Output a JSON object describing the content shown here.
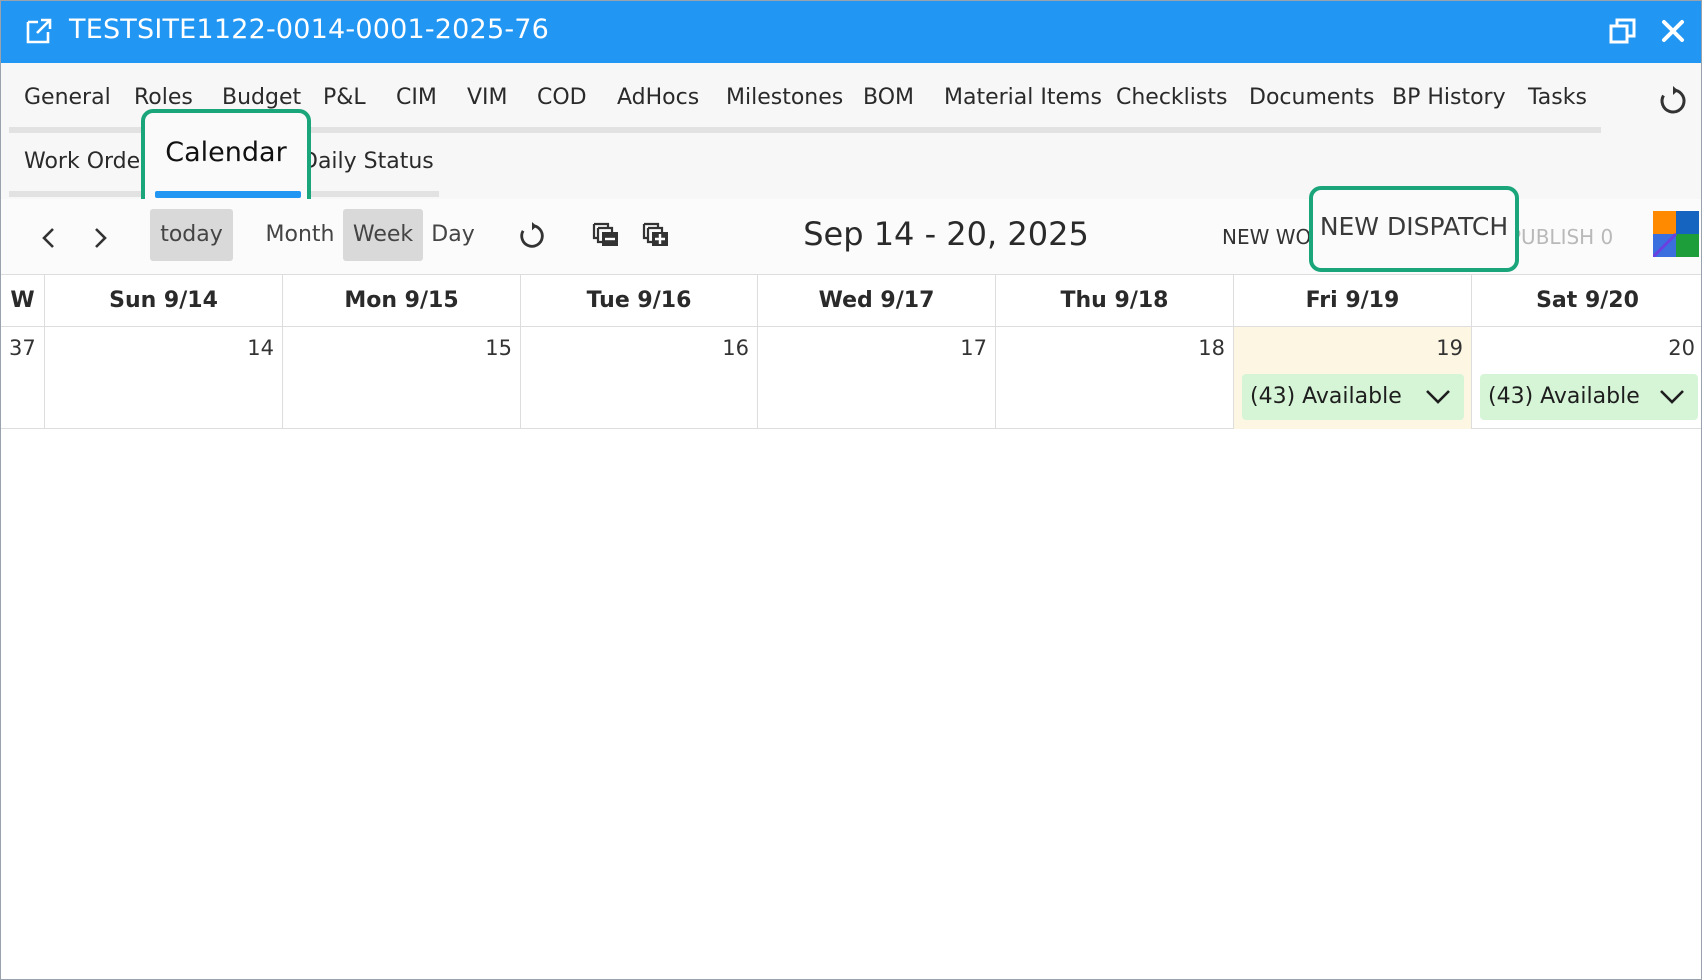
{
  "window": {
    "title": "TESTSITE1122-0014-0001-2025-76",
    "icons": [
      "open-external-icon",
      "restore-icon",
      "close-icon"
    ],
    "accent_color": "#2196f3"
  },
  "tabs": {
    "row1": [
      "General",
      "Roles",
      "Budget",
      "P&L",
      "CIM",
      "VIM",
      "COD",
      "AdHocs",
      "Milestones",
      "BOM",
      "Material Items",
      "Checklists",
      "Documents",
      "BP History",
      "Tasks"
    ],
    "row2": [
      "Work Order",
      "Calendar",
      "Daily Status"
    ],
    "active": "Calendar",
    "highlight_color": "#1aa67a"
  },
  "toolbar": {
    "views": [
      "today",
      "Month",
      "Week",
      "Day"
    ],
    "active_view": "Week",
    "range_title": "Sep 14 - 20, 2025",
    "new_wo_label": "NEW WO",
    "new_dispatch_label": "NEW DISPATCH",
    "publish_label": "PUBLISH 0",
    "icons": [
      "chevron-left-icon",
      "chevron-right-icon",
      "refresh-icon",
      "collapse-all-icon",
      "expand-all-icon",
      "color-legend-icon"
    ]
  },
  "calendar": {
    "week_col_header": "W",
    "headers": [
      "Sun 9/14",
      "Mon 9/15",
      "Tue 9/16",
      "Wed 9/17",
      "Thu 9/18",
      "Fri 9/19",
      "Sat 9/20"
    ],
    "week_number": "37",
    "day_numbers": [
      "14",
      "15",
      "16",
      "17",
      "18",
      "19",
      "20"
    ],
    "today_index": 5,
    "availability": [
      {
        "day_index": 5,
        "label": "(43) Available"
      },
      {
        "day_index": 6,
        "label": "(43) Available"
      }
    ],
    "today_color": "#fdf6e3",
    "available_color": "#d6f5d6"
  }
}
